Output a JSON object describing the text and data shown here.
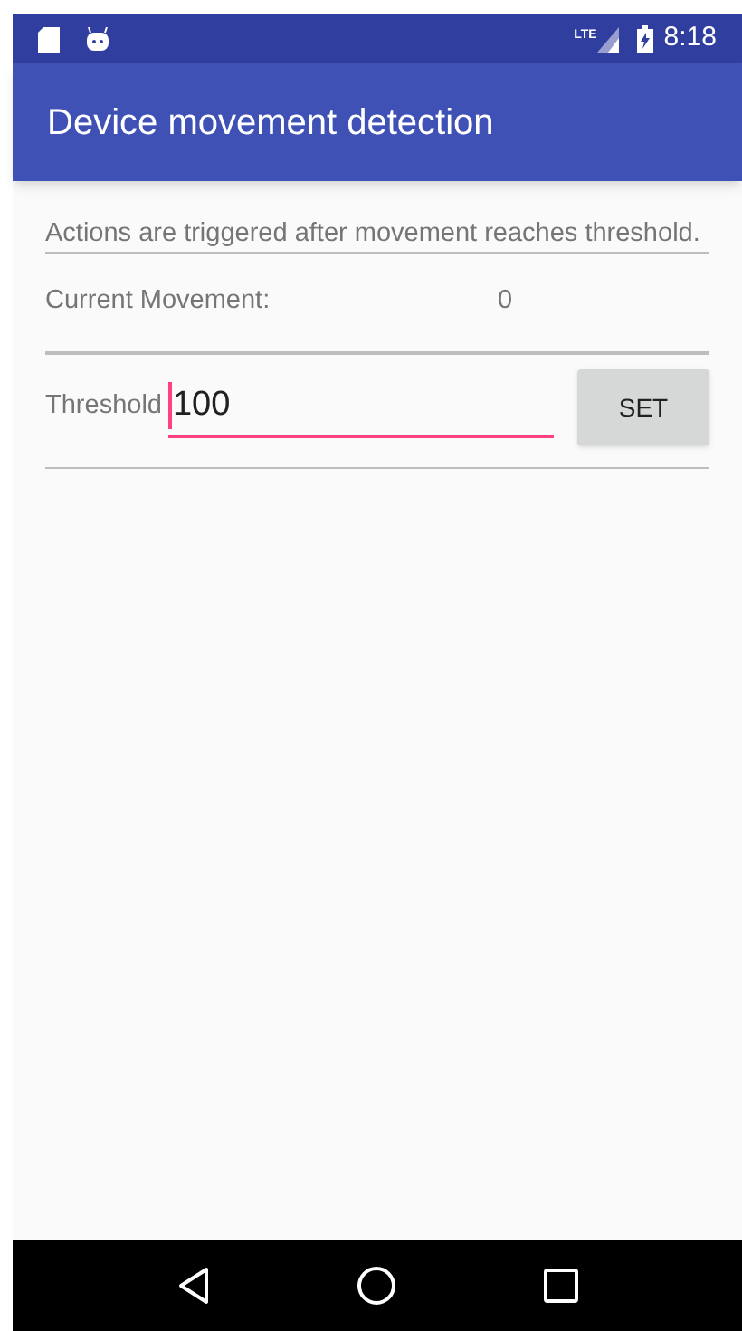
{
  "status_bar": {
    "time": "8:18",
    "network": "LTE"
  },
  "app_bar": {
    "title": "Device movement detection"
  },
  "description": "Actions are triggered after movement reaches threshold.",
  "current_movement": {
    "label": "Current Movement:",
    "value": "0"
  },
  "threshold": {
    "label": "Threshold",
    "value": "100",
    "focused": true
  },
  "set_button": "SET"
}
